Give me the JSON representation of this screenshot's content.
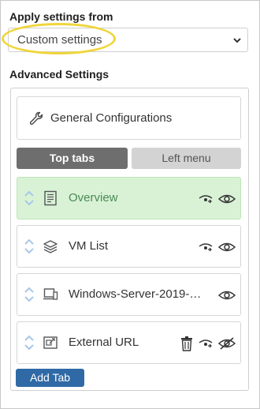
{
  "apply": {
    "label": "Apply settings from",
    "selected_value": "Custom settings"
  },
  "advanced": {
    "label": "Advanced Settings",
    "general_configurations": "General Configurations",
    "segments": {
      "top_tabs": "Top tabs",
      "left_menu": "Left menu",
      "active": "Top tabs"
    },
    "tabs": [
      {
        "label": "Overview",
        "icon": "document-icon",
        "selected": true,
        "actions": [
          "hide-link-icon",
          "eye-icon"
        ]
      },
      {
        "label": "VM List",
        "icon": "layers-icon",
        "selected": false,
        "actions": [
          "hide-link-icon",
          "eye-icon"
        ]
      },
      {
        "label": "Windows-Server-2019-…",
        "icon": "monitor-icon",
        "selected": false,
        "actions": [
          "eye-icon"
        ]
      },
      {
        "label": "External URL",
        "icon": "external-link-icon",
        "selected": false,
        "actions": [
          "trash-icon",
          "hide-link-icon",
          "eye-off-icon"
        ]
      }
    ],
    "add_tab_label": "Add Tab"
  },
  "colors": {
    "highlight": "#f0d53a",
    "selected_row_bg": "#d9f2d6",
    "primary_button": "#2f6aa6",
    "active_segment": "#6e6e6e"
  }
}
